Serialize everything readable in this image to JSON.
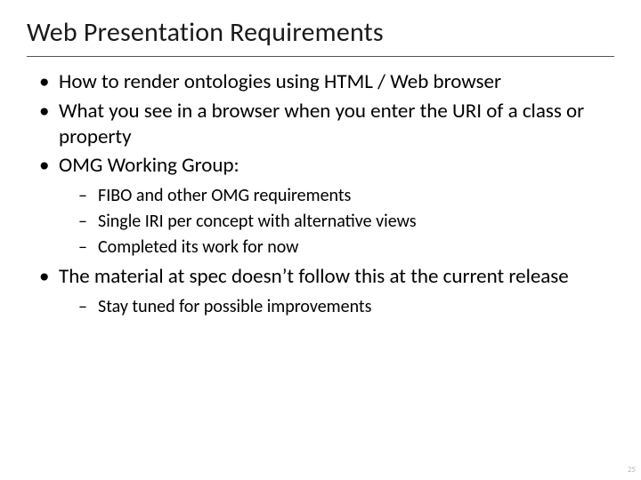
{
  "title": "Web Presentation Requirements",
  "bullets": {
    "b0": "How to render ontologies using HTML / Web browser",
    "b1": "What you see in a browser when you enter the URI of a class or property",
    "b2": "OMG Working Group:",
    "b2_sub": {
      "s0": "FIBO and other OMG requirements",
      "s1": "Single IRI per concept with alternative views",
      "s2": "Completed its work for now"
    },
    "b3": "The material at spec doesn’t follow this at the current release",
    "b3_sub": {
      "s0": "Stay tuned for possible improvements"
    }
  },
  "page_number": "25"
}
